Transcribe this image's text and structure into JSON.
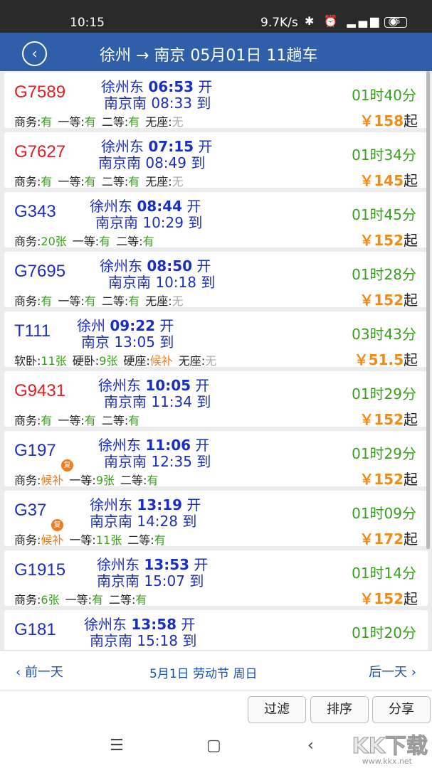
{
  "status_bar": {
    "time": "10:15",
    "network_speed": "9.7K/s",
    "icons": "✱ ⏰ ▂▄▆ ◉",
    "battery": "45"
  },
  "header": {
    "back_glyph": "‹",
    "title": "徐州 → 南京 05月01日 11趟车"
  },
  "trains": [
    {
      "no": "G7589",
      "color": "red",
      "badge": "",
      "dep_station": "徐州东",
      "dep_time": "06:53",
      "dep_suffix": "开",
      "arr_station": "南京南",
      "arr_time": "08:33",
      "arr_suffix": "到",
      "duration": "01时40分",
      "price": "￥158",
      "price_suffix": "起",
      "seats": [
        {
          "label": "商务:",
          "value": "有",
          "status": "green"
        },
        {
          "label": "一等:",
          "value": "有",
          "status": "green"
        },
        {
          "label": "二等:",
          "value": "有",
          "status": "green"
        },
        {
          "label": "无座:",
          "value": "无",
          "status": "gray"
        }
      ]
    },
    {
      "no": "G7627",
      "color": "red",
      "badge": "",
      "dep_station": "徐州东",
      "dep_time": "07:15",
      "dep_suffix": "开",
      "arr_station": "南京南",
      "arr_time": "08:49",
      "arr_suffix": "到",
      "duration": "01时34分",
      "price": "￥145",
      "price_suffix": "起",
      "seats": [
        {
          "label": "商务:",
          "value": "有",
          "status": "green"
        },
        {
          "label": "一等:",
          "value": "有",
          "status": "green"
        },
        {
          "label": "二等:",
          "value": "有",
          "status": "green"
        },
        {
          "label": "无座:",
          "value": "无",
          "status": "gray"
        }
      ]
    },
    {
      "no": "G343",
      "color": "blue",
      "badge": "",
      "dep_station": "徐州东",
      "dep_time": "08:44",
      "dep_suffix": "开",
      "arr_station": "南京南",
      "arr_time": "10:29",
      "arr_suffix": "到",
      "duration": "01时45分",
      "price": "￥152",
      "price_suffix": "起",
      "seats": [
        {
          "label": "商务:",
          "value": "20张",
          "status": "green"
        },
        {
          "label": "一等:",
          "value": "有",
          "status": "green"
        },
        {
          "label": "二等:",
          "value": "有",
          "status": "green"
        }
      ]
    },
    {
      "no": "G7695",
      "color": "blue",
      "badge": "",
      "dep_station": "徐州东",
      "dep_time": "08:50",
      "dep_suffix": "开",
      "arr_station": "南京南",
      "arr_time": "10:18",
      "arr_suffix": "到",
      "duration": "01时28分",
      "price": "￥152",
      "price_suffix": "起",
      "seats": [
        {
          "label": "商务:",
          "value": "有",
          "status": "green"
        },
        {
          "label": "一等:",
          "value": "有",
          "status": "green"
        },
        {
          "label": "二等:",
          "value": "有",
          "status": "green"
        },
        {
          "label": "无座:",
          "value": "无",
          "status": "gray"
        }
      ]
    },
    {
      "no": "T111",
      "color": "blue",
      "badge": "",
      "dep_station": "徐州",
      "dep_time": "09:22",
      "dep_suffix": "开",
      "arr_station": "南京",
      "arr_time": "13:05",
      "arr_suffix": "到",
      "duration": "03时43分",
      "price": "￥51.5",
      "price_suffix": "起",
      "seats": [
        {
          "label": "软卧:",
          "value": "11张",
          "status": "green"
        },
        {
          "label": "硬卧:",
          "value": "9张",
          "status": "green"
        },
        {
          "label": "硬座:",
          "value": "候补",
          "status": "orange"
        },
        {
          "label": "无座:",
          "value": "无",
          "status": "gray"
        }
      ]
    },
    {
      "no": "G9431",
      "color": "red",
      "badge": "",
      "dep_station": "徐州东",
      "dep_time": "10:05",
      "dep_suffix": "开",
      "arr_station": "南京南",
      "arr_time": "11:34",
      "arr_suffix": "到",
      "duration": "01时29分",
      "price": "￥152",
      "price_suffix": "起",
      "seats": [
        {
          "label": "商务:",
          "value": "有",
          "status": "green"
        },
        {
          "label": "一等:",
          "value": "有",
          "status": "green"
        },
        {
          "label": "二等:",
          "value": "有",
          "status": "green"
        }
      ]
    },
    {
      "no": "G197",
      "color": "blue",
      "badge": "复",
      "dep_station": "徐州东",
      "dep_time": "11:06",
      "dep_suffix": "开",
      "arr_station": "南京南",
      "arr_time": "12:35",
      "arr_suffix": "到",
      "duration": "01时29分",
      "price": "￥152",
      "price_suffix": "起",
      "seats": [
        {
          "label": "商务:",
          "value": "候补",
          "status": "orange"
        },
        {
          "label": "一等:",
          "value": "9张",
          "status": "green"
        },
        {
          "label": "二等:",
          "value": "有",
          "status": "green"
        }
      ]
    },
    {
      "no": "G37",
      "color": "blue",
      "badge": "复",
      "dep_station": "徐州东",
      "dep_time": "13:19",
      "dep_suffix": "开",
      "arr_station": "南京南",
      "arr_time": "14:28",
      "arr_suffix": "到",
      "duration": "01时09分",
      "price": "￥172",
      "price_suffix": "起",
      "seats": [
        {
          "label": "商务:",
          "value": "候补",
          "status": "orange"
        },
        {
          "label": "一等:",
          "value": "11张",
          "status": "green"
        },
        {
          "label": "二等:",
          "value": "有",
          "status": "green"
        }
      ]
    },
    {
      "no": "G1915",
      "color": "blue",
      "badge": "",
      "dep_station": "徐州东",
      "dep_time": "13:53",
      "dep_suffix": "开",
      "arr_station": "南京南",
      "arr_time": "15:07",
      "arr_suffix": "到",
      "duration": "01时14分",
      "price": "￥152",
      "price_suffix": "起",
      "seats": [
        {
          "label": "商务:",
          "value": "6张",
          "status": "green"
        },
        {
          "label": "一等:",
          "value": "有",
          "status": "green"
        },
        {
          "label": "二等:",
          "value": "有",
          "status": "green"
        }
      ]
    },
    {
      "no": "G181",
      "color": "blue",
      "badge": "",
      "dep_station": "徐州东",
      "dep_time": "13:58",
      "dep_suffix": "开",
      "arr_station": "南京南",
      "arr_time": "15:18",
      "arr_suffix": "到",
      "duration": "01时20分",
      "price": "",
      "price_suffix": "",
      "seats": []
    }
  ],
  "date_nav": {
    "prev": "前一天",
    "current": "5月1日  劳动节  周日",
    "next": "后一天",
    "prev_glyph": "‹",
    "next_glyph": "›"
  },
  "actions": {
    "filter": "过滤",
    "sort": "排序",
    "share": "分享"
  },
  "system_nav": {
    "menu": "☰",
    "home": "▢",
    "back": "‹"
  },
  "watermark": {
    "logo": "KK下载",
    "url": "www.kkx.net"
  },
  "colors": {
    "header_bg": "#2f5fa8",
    "train_red": "#e31e1e",
    "train_blue": "#1a2fbf",
    "available_green": "#3a9e1e",
    "waitlist_orange": "#f07a1e",
    "price_orange": "#f08a1a"
  }
}
